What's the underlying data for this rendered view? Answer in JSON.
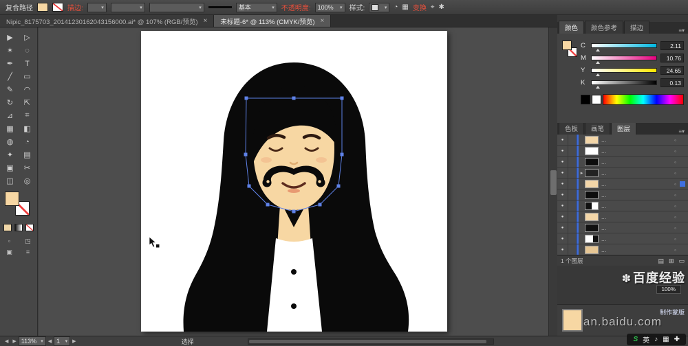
{
  "toolbar": {
    "title": "复合路径",
    "stroke_label": "描边:",
    "brush_name": "基本",
    "opacity_label": "不透明度:",
    "opacity_value": "100%",
    "style_label": "样式:",
    "transform_label": "变换",
    "icons": {
      "setup": "◔",
      "grid": "▦",
      "free": "⌖",
      "gear": "✱"
    }
  },
  "tabs": [
    {
      "title": "Nipic_8175703_20141230162043156000.ai* @ 107% (RGB/预览)",
      "close": "×"
    },
    {
      "title": "未标题-6* @ 113% (CMYK/预览)",
      "close": "×"
    }
  ],
  "tools": [
    "▶",
    "▷",
    "✶",
    "◌",
    "✒",
    "T",
    "╱",
    "▭",
    "✎",
    "◠",
    "↻",
    "⇱",
    "⊿",
    "⌗",
    "▦",
    "◧",
    "◍",
    "◔",
    "✦",
    "▤",
    "▣",
    "✂",
    "◫",
    "◎"
  ],
  "tool_footer": [
    "▫",
    "◳",
    "▣",
    "≡"
  ],
  "color_panel": {
    "tabs": [
      "颜色",
      "颜色参考",
      "描边"
    ],
    "sliders": [
      {
        "label": "C",
        "value": "2.11",
        "gradient": "linear-gradient(90deg,#ffffff,#00b6e0)"
      },
      {
        "label": "M",
        "value": "10.76",
        "gradient": "linear-gradient(90deg,#ffffff,#e6007e)"
      },
      {
        "label": "Y",
        "value": "24.65",
        "gradient": "linear-gradient(90deg,#ffffff,#ffe600)"
      },
      {
        "label": "K",
        "value": "0.13",
        "gradient": "linear-gradient(90deg,#ffffff,#000000)"
      }
    ]
  },
  "dock_tabs": [
    "色板",
    "画笔",
    "图层"
  ],
  "layers": {
    "rows": [
      {
        "name": "...",
        "thumb": "#f3d6a8",
        "expander": "",
        "sel": "transparent"
      },
      {
        "name": "...",
        "thumb": "#ffffff",
        "expander": "",
        "sel": "transparent"
      },
      {
        "name": "...",
        "thumb": "#0d0d0d",
        "expander": "",
        "sel": "transparent"
      },
      {
        "name": "...",
        "thumb": "#222222",
        "expander": "▸",
        "sel": "transparent"
      },
      {
        "name": "...",
        "thumb": "#f3d6a8",
        "expander": "",
        "sel": "#3f6fe0"
      },
      {
        "name": "...",
        "thumb": "#0d0d0d",
        "expander": "",
        "sel": "transparent"
      },
      {
        "name": "...",
        "thumb": "linear-gradient(90deg,#111 50%,#fff 50%)",
        "expander": "",
        "sel": "transparent"
      },
      {
        "name": "...",
        "thumb": "#f3d6a8",
        "expander": "",
        "sel": "transparent"
      },
      {
        "name": "...",
        "thumb": "#101010",
        "expander": "",
        "sel": "transparent"
      },
      {
        "name": "...",
        "thumb": "linear-gradient(90deg,#fff 60%,#111 60%)",
        "expander": "",
        "sel": "transparent"
      },
      {
        "name": "...",
        "thumb": "#e6c694",
        "expander": "",
        "sel": "transparent"
      }
    ],
    "footer": "1 个图层",
    "footer_icons": [
      "▤",
      "⊞",
      "▭"
    ]
  },
  "status": {
    "zoom": "113%",
    "page": "1",
    "label": "选择"
  },
  "watermark": {
    "logo": "✽",
    "brand": "百度经验",
    "percent": "100%",
    "url": "an.baidu.com",
    "mask_button": "制作蒙版"
  },
  "ime": {
    "logo": "S",
    "lang": "英",
    "icons": [
      "♪",
      "▦",
      "✚"
    ]
  },
  "art": {
    "skin": "#f7d7a3",
    "hair": "#0a0a0a",
    "shirt": "#ffffff",
    "blush": "#f2b98c",
    "selection": "#5f82e8"
  }
}
